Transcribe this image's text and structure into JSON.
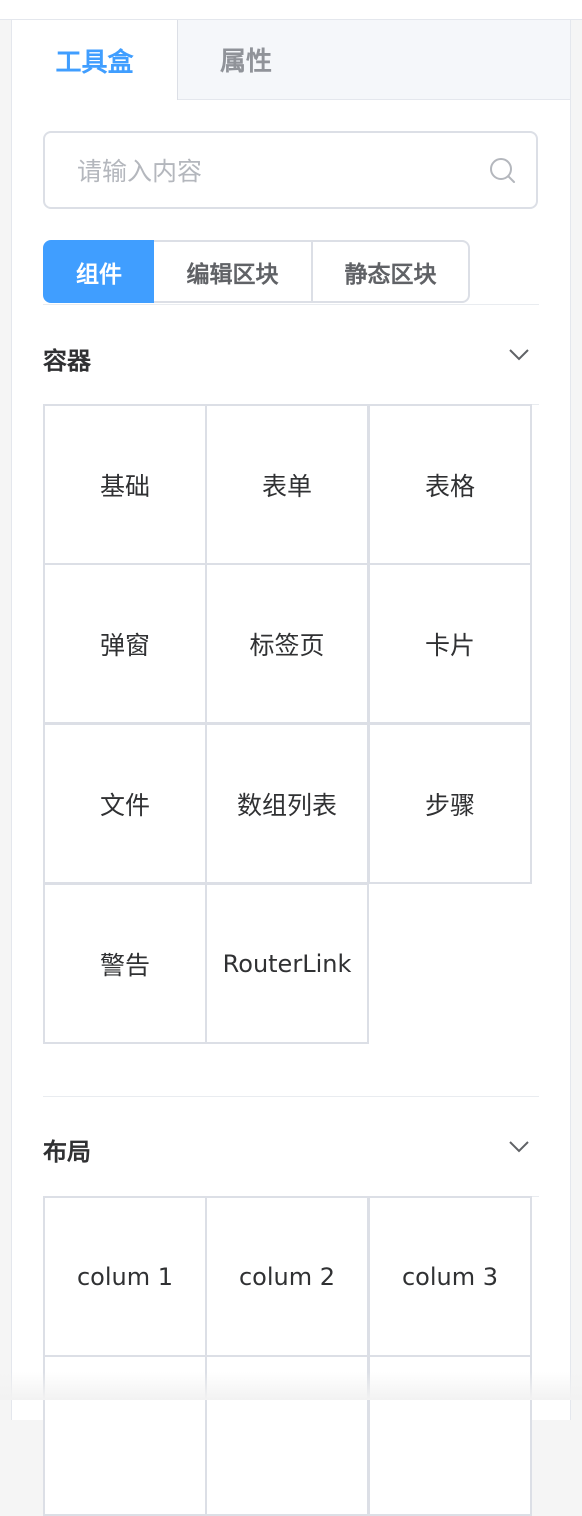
{
  "tabs": {
    "toolbox": "工具盒",
    "properties": "属性"
  },
  "search": {
    "placeholder": "请输入内容",
    "value": ""
  },
  "segments": [
    "组件",
    "编辑区块",
    "静态区块"
  ],
  "containers": {
    "title": "容器",
    "items": [
      "基础",
      "表单",
      "表格",
      "弹窗",
      "标签页",
      "卡片",
      "文件",
      "数组列表",
      "步骤",
      "警告",
      "RouterLink"
    ]
  },
  "layout": {
    "title": "布局",
    "items": [
      "colum 1",
      "colum 2",
      "colum 3"
    ]
  },
  "colors": {
    "accent": "#409eff",
    "border": "#dcdfe6",
    "text": "#303133"
  },
  "icons": {
    "search": "search-icon",
    "collapse": "chevron-down-icon"
  }
}
